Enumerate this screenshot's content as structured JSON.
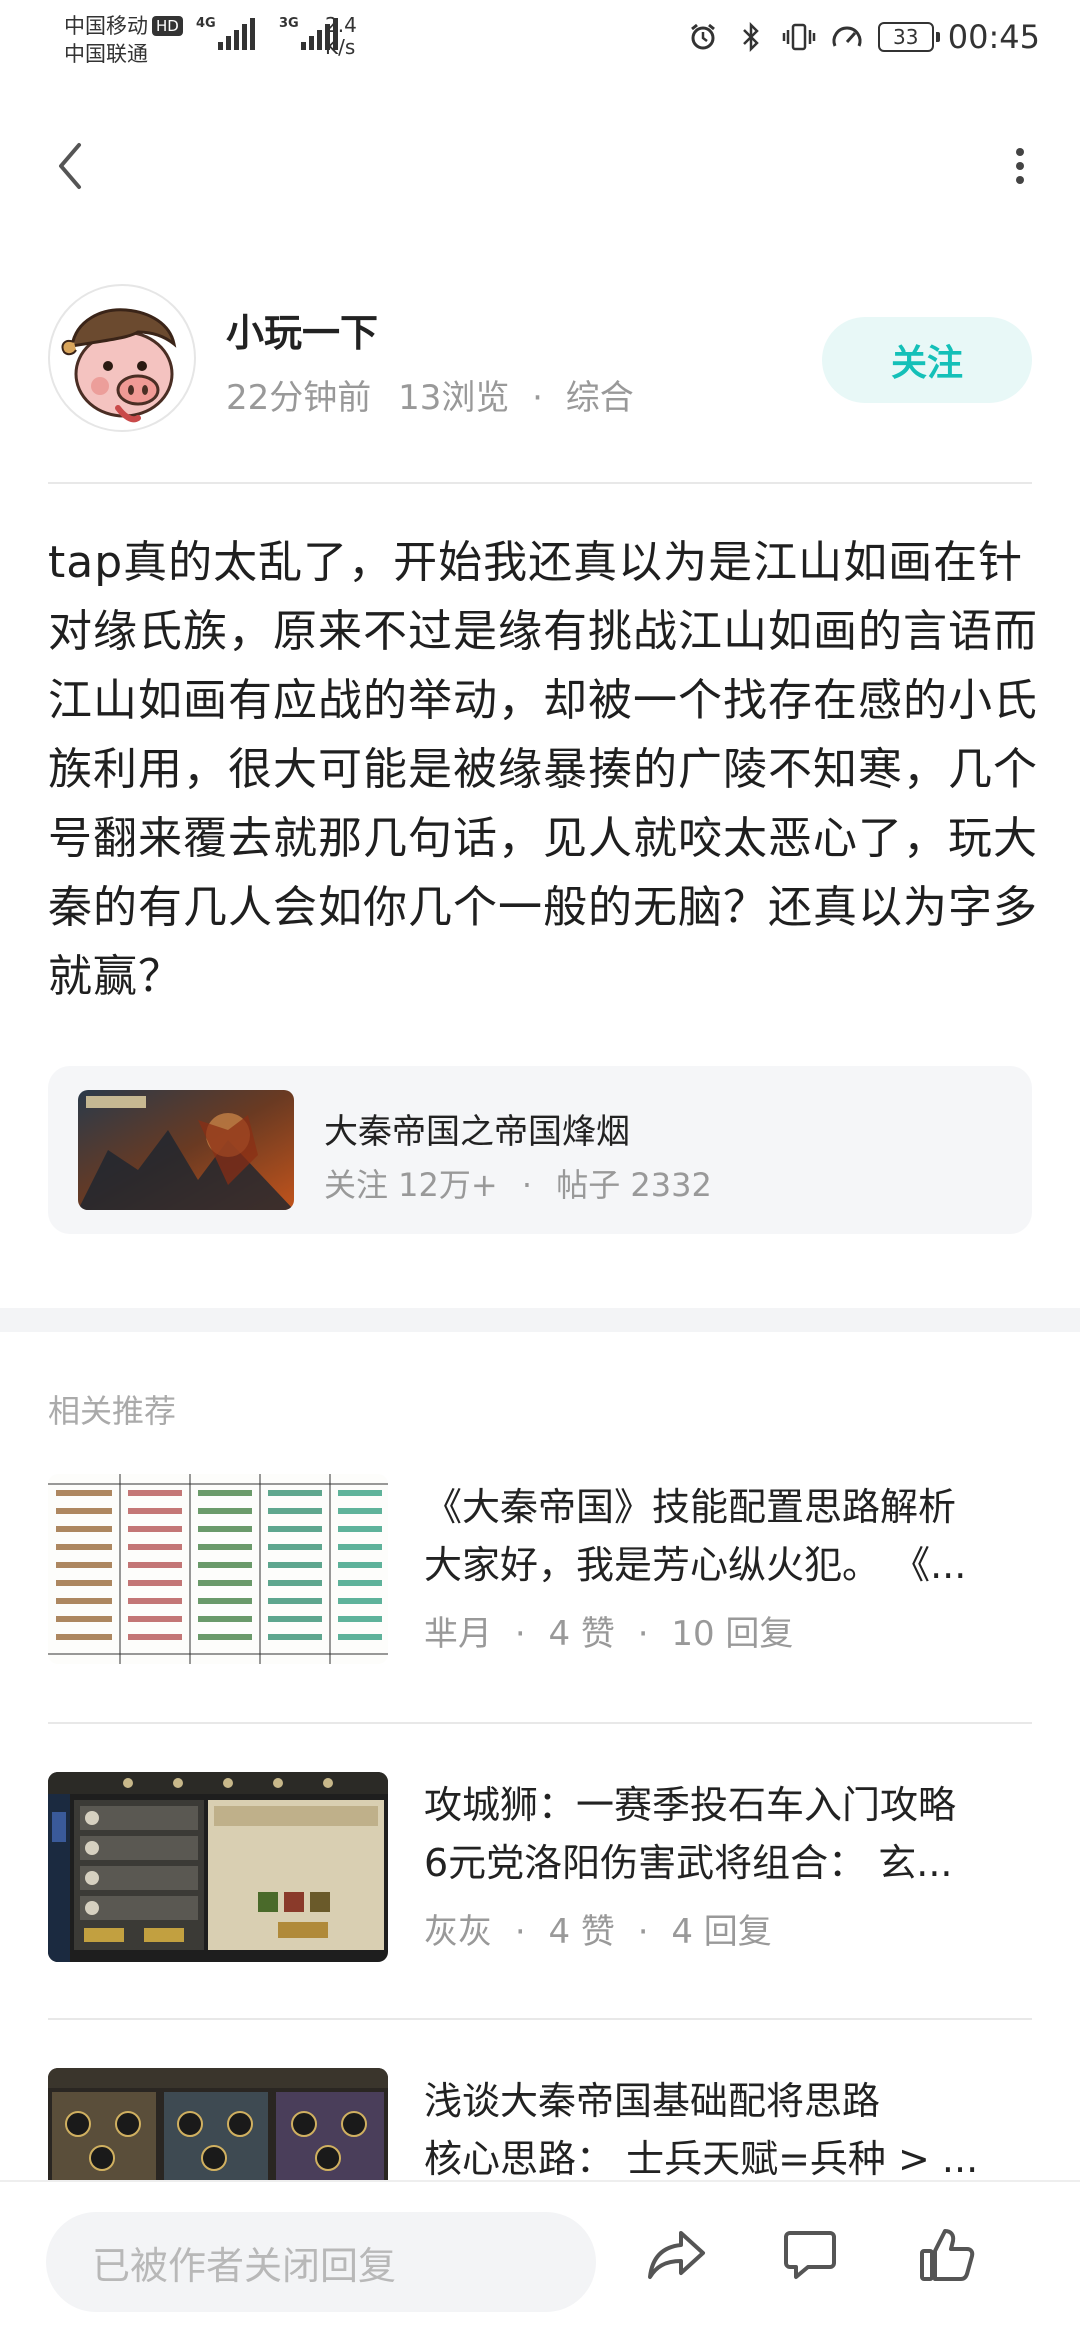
{
  "status_bar": {
    "carrier_1": "中国移动",
    "hd": "HD",
    "carrier_2": "中国联通",
    "signal_1_tag": "4G",
    "signal_2_tag": "3G",
    "net_speed_value": "2.4",
    "net_speed_unit": "K/s",
    "battery": "33",
    "time": "00:45"
  },
  "author": {
    "name": "小玩一下",
    "time_ago": "22分钟前",
    "views": "13浏览",
    "category": "综合",
    "follow_label": "关注"
  },
  "post": {
    "content": "tap真的太乱了，开始我还真以为是江山如画在针对缘氏族，原来不过是缘有挑战江山如画的言语而江山如画有应战的举动，却被一个找存在感的小氏族利用，很大可能是被缘暴揍的广陵不知寒，几个号翻来覆去就那几句话，见人就咬太恶心了，玩大秦的有几人会如你几个一般的无脑？还真以为字多就赢？"
  },
  "forum": {
    "name": "大秦帝国之帝国烽烟",
    "followers": "关注 12万+",
    "posts": "帖子 2332"
  },
  "related": {
    "title": "相关推荐",
    "items": [
      {
        "title": "《大秦帝国》技能配置思路解析",
        "subtitle": "大家好，我是芳心纵火犯。 《...",
        "author": "芈月",
        "likes": "4 赞",
        "replies": "10 回复"
      },
      {
        "title": "攻城狮：一赛季投石车入门攻略",
        "subtitle": "6元党洛阳伤害武将组合： 玄...",
        "author": "灰灰",
        "likes": "4 赞",
        "replies": "4 回复"
      },
      {
        "title": "浅谈大秦帝国基础配将思路",
        "subtitle": "核心思路： 士兵天赋=兵种 > ...",
        "author": "",
        "likes": "",
        "replies": ""
      }
    ]
  },
  "bottom_bar": {
    "reply_placeholder": "已被作者关闭回复"
  }
}
